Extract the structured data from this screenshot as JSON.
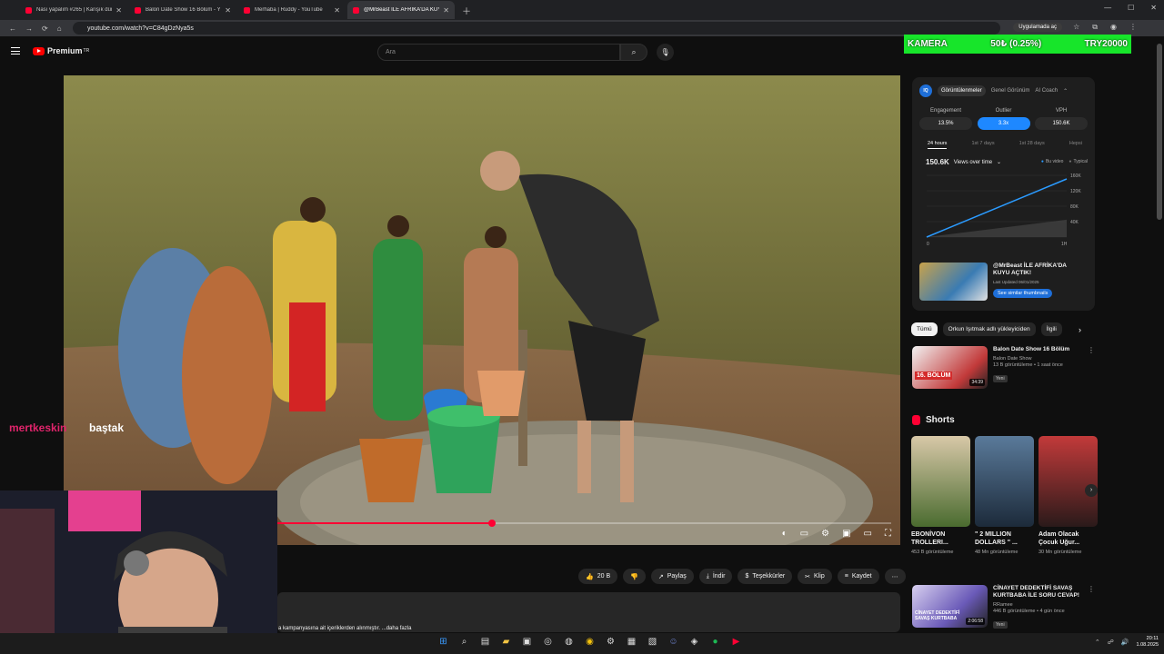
{
  "browser": {
    "tabs": [
      {
        "title": "Nası yapalım #265 | Karışık dün",
        "active": false
      },
      {
        "title": "Balon Date Show 16 Bölüm - Y",
        "active": false
      },
      {
        "title": "Merhaba | Ruddy - YouTube",
        "active": false
      },
      {
        "title": "@MrBeast İLE AFRİKA'DA KUYU",
        "active": true
      }
    ],
    "url": "youtube.com/watch?v=C84gDzNya5s",
    "open_app_label": "Uygulamada aç"
  },
  "ticker": {
    "left": "KAMERA",
    "mid": "50₺ (0.25%)",
    "right": "TRY20000"
  },
  "youtube": {
    "logo_text": "Premium",
    "logo_sup": "TR",
    "search_placeholder": "Ara"
  },
  "player": {
    "progress": 0.35,
    "overlay_chat_name": "mertkeskin",
    "overlay_chat_msg": "baştak"
  },
  "actions": [
    {
      "icon": "thumbs-up-icon",
      "label": "20 B"
    },
    {
      "icon": "thumbs-down-icon",
      "label": ""
    },
    {
      "icon": "share-icon",
      "label": "Paylaş"
    },
    {
      "icon": "download-icon",
      "label": "İndir"
    },
    {
      "icon": "thanks-icon",
      "label": "Teşekkürler"
    },
    {
      "icon": "clip-icon",
      "label": "Klip"
    },
    {
      "icon": "save-icon",
      "label": "Kaydet"
    }
  ],
  "description_snippet": "a kampanyasına ait içeriklerden alınmıştır. ...daha fazla",
  "analytics": {
    "logo": "IQ",
    "tabs": [
      "Görüntülenmeler",
      "Genel Görünüm",
      "AI Coach"
    ],
    "metrics": [
      {
        "label": "Engagement",
        "value": "13.5%"
      },
      {
        "label": "Outlier",
        "value": "3.3x"
      },
      {
        "label": "VPH",
        "value": "150.6K"
      }
    ],
    "periods": [
      "24 hours",
      "1st 7 days",
      "1st 28 days",
      "Hepsi"
    ],
    "views_total": "150.6K",
    "views_dropdown": "Views over time",
    "legend": [
      "Bu video",
      "Typical"
    ],
    "video_title": "@MrBeast İLE AFRİKA'DA KUYU AÇTIK!",
    "last_updated": "Last Updated 06/01/2025",
    "similar_btn": "See similar thumbnails"
  },
  "chart_data": {
    "type": "line",
    "x": [
      0,
      1
    ],
    "xlabels": [
      "0",
      "1H"
    ],
    "ylabels": [
      "0",
      "40K",
      "80K",
      "120K",
      "160K"
    ],
    "ylim": [
      0,
      160000
    ],
    "series": [
      {
        "name": "Bu video",
        "values": [
          0,
          150600
        ]
      },
      {
        "name": "Typical",
        "values": [
          0,
          45000
        ]
      }
    ]
  },
  "chips": [
    "Tümü",
    "Orkun Işıtmak adlı yükleyiciden",
    "İlgili"
  ],
  "recs": [
    {
      "title": "Balon Date Show 16 Bölüm",
      "channel": "Balon Date Show",
      "meta": "13 B görüntüleme • 1 saat önce",
      "badge": "Yeni",
      "duration": "34:39",
      "thumb": "16. BÖLÜM"
    },
    {
      "title": "CİNAYET DEDEKTİFİ SAVAŞ KURTBABA İLE SORU CEVAP!",
      "channel": "RRamee",
      "meta": "446 B görüntüleme • 4 gün önce",
      "badge": "Yeni",
      "duration": "2:06:58",
      "thumb": "CİNAYET DEDEKTİFİ SAVAŞ KURTBABA"
    }
  ],
  "shorts_header": "Shorts",
  "shorts": [
    {
      "title": "EBONİVON TROLLERI...",
      "views": "453 B görüntüleme"
    },
    {
      "title": "\" 2 MILLION DOLLARS \" ...",
      "views": "48 Mn görüntüleme"
    },
    {
      "title": "Adam Olacak Çocuk Uğur...",
      "views": "30 Mn görüntüleme"
    }
  ],
  "taskbar": {
    "time": "20:11",
    "date": "1.08.2025"
  }
}
